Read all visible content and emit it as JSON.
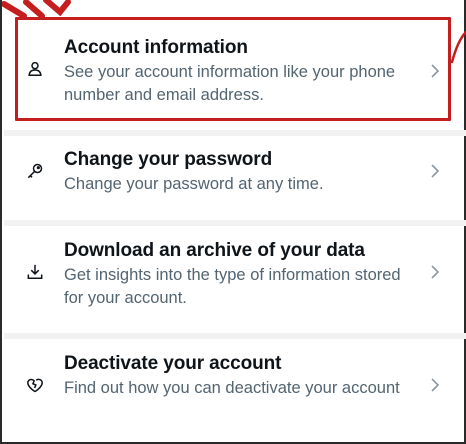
{
  "settings_items": [
    {
      "id": "account-information",
      "icon": "person-icon",
      "title": "Account information",
      "description": "See your account information like your phone number and email address."
    },
    {
      "id": "change-password",
      "icon": "key-icon",
      "title": "Change your password",
      "description": "Change your password at any time."
    },
    {
      "id": "download-archive",
      "icon": "download-icon",
      "title": "Download an archive of your data",
      "description": "Get insights into the type of information stored for your account."
    },
    {
      "id": "deactivate-account",
      "icon": "broken-heart-icon",
      "title": "Deactivate your account",
      "description": "Find out how you can deactivate your account"
    }
  ],
  "colors": {
    "title": "#0f1419",
    "description": "#536471",
    "chevron": "#8b98a5",
    "annotation": "#c41e1e",
    "divider": "#f2f2f2"
  }
}
